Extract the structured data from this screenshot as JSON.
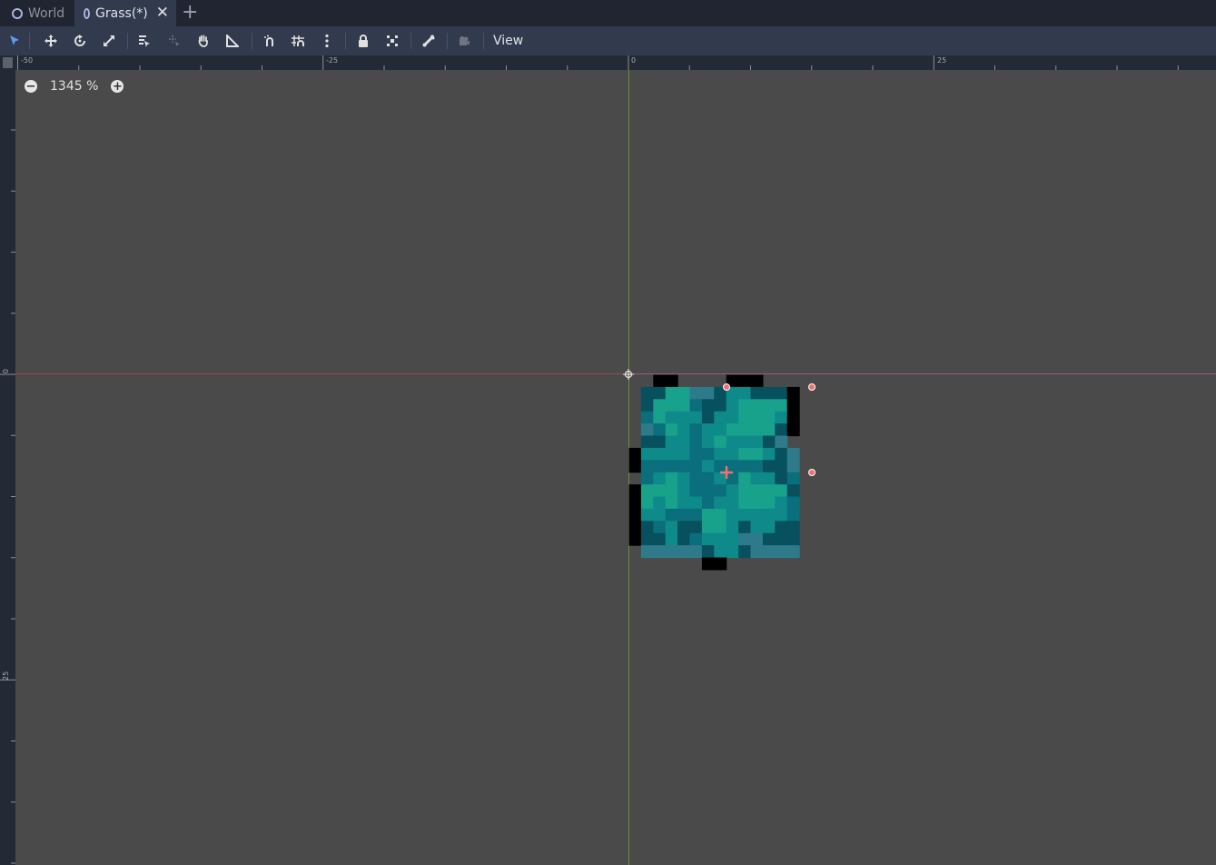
{
  "tabs": [
    {
      "label": "World",
      "active": false
    },
    {
      "label": "Grass(*)",
      "active": true
    }
  ],
  "tab_close_glyph": "✕",
  "tab_add_glyph": "+",
  "toolbar": {
    "view_label": "View",
    "icons": [
      "select-icon",
      "move-icon",
      "rotate-icon",
      "scale-icon",
      "list-select-icon",
      "pivot-icon",
      "pan-icon",
      "ruler-icon",
      "snap-icon",
      "grid-snap-icon",
      "more-icon",
      "lock-icon",
      "group-icon",
      "skeleton-icon",
      "camera-icon"
    ]
  },
  "zoom": {
    "value": "1345 %",
    "minus": "−",
    "plus": "+"
  },
  "ruler": {
    "top_labels": [
      "-50",
      "-25",
      "0",
      "25"
    ],
    "left_labels": [
      "0",
      "25"
    ]
  },
  "colors": {
    "tabbar_bg": "#202531",
    "toolbar_bg": "#323a4d",
    "viewport_bg": "#4a4a4a",
    "accent_selected": "#5f9cf2",
    "handle": "#f07070"
  },
  "sprite": {
    "name": "Grass",
    "palette": {
      "K": "#000000",
      "L": "#18a18b",
      "M": "#0e8a8a",
      "D": "#0a6e7c",
      "E": "#07505e",
      "S": "#2f7a8a",
      "_": ""
    },
    "rows": [
      "__KK____KKK___",
      "_EELLSSEMMEEEK",
      "_ELLLDEEMLLLLK",
      "_DLMMMEMMLLLMK",
      "_SDLMDMMLLLLEK",
      "_EEMMDMLMMMES_",
      "KMMMMDDMMLLMES_",
      "KDDDDDMDDDDEES",
      "_DMLMDDMDLMMED",
      "KLLLMDDDMLLLLE",
      "KLMLMMDMMLLLMD",
      "KMMDDDLLMMMMMD",
      "KEDMEELLMEMMEE",
      "KEEMEDMMMSSEEE",
      "_SSSSSEMMESSSS",
      "______KK______"
    ]
  }
}
